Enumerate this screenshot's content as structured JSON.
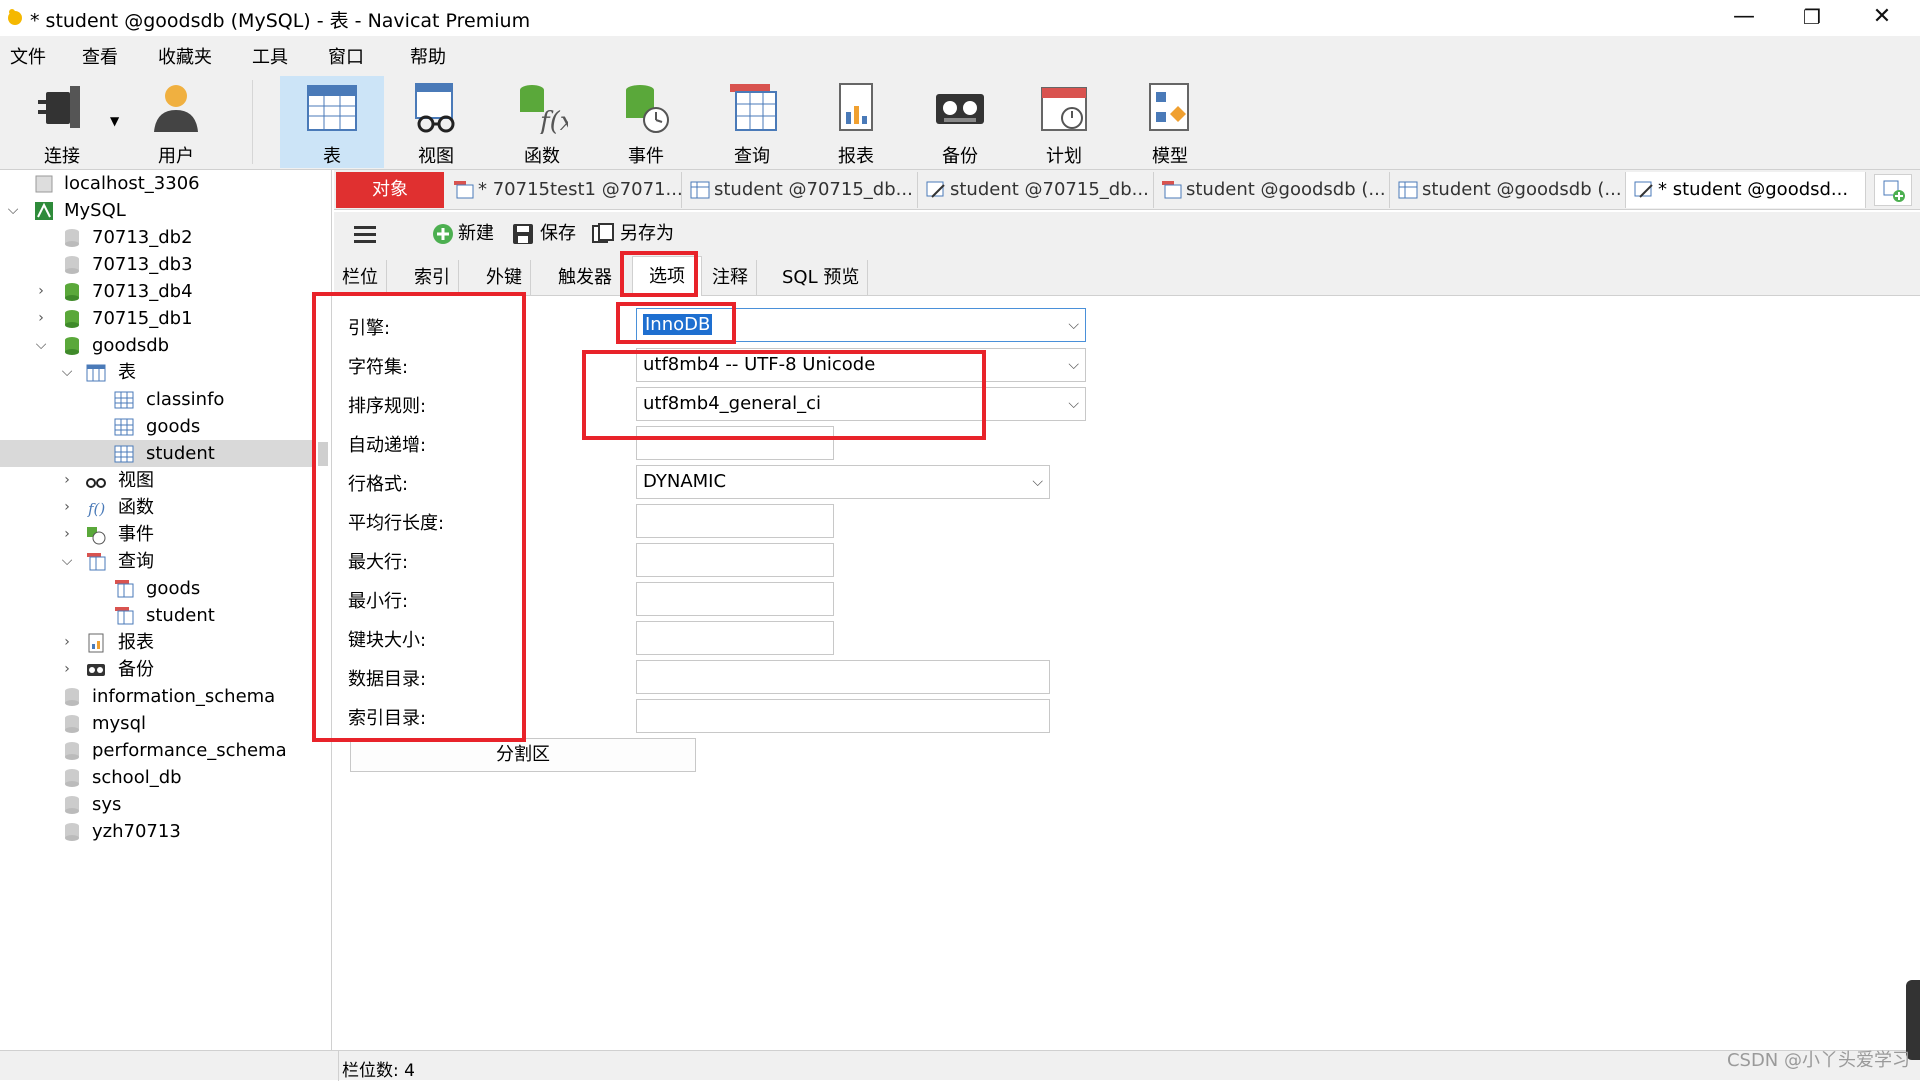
{
  "window": {
    "title": "* student @goodsdb (MySQL) - 表 - Navicat Premium",
    "minimize": "—",
    "restore": "❐",
    "close": "✕"
  },
  "menu": [
    "文件",
    "查看",
    "收藏夹",
    "工具",
    "窗口",
    "帮助"
  ],
  "toolbar": {
    "items": [
      {
        "label": "连接",
        "icon": "plug-icon"
      },
      {
        "label": "用户",
        "icon": "user-icon"
      },
      {
        "label": "表",
        "icon": "table-icon",
        "active": true
      },
      {
        "label": "视图",
        "icon": "view-icon"
      },
      {
        "label": "函数",
        "icon": "function-icon"
      },
      {
        "label": "事件",
        "icon": "event-icon"
      },
      {
        "label": "查询",
        "icon": "query-icon"
      },
      {
        "label": "报表",
        "icon": "report-icon"
      },
      {
        "label": "备份",
        "icon": "backup-icon"
      },
      {
        "label": "计划",
        "icon": "schedule-icon"
      },
      {
        "label": "模型",
        "icon": "model-icon"
      }
    ]
  },
  "sidebar": {
    "items": [
      {
        "label": "localhost_3306"
      },
      {
        "label": "MySQL"
      },
      {
        "label": "70713_db2"
      },
      {
        "label": "70713_db3"
      },
      {
        "label": "70713_db4"
      },
      {
        "label": "70715_db1"
      },
      {
        "label": "goodsdb"
      },
      {
        "label": "表"
      },
      {
        "label": "classinfo"
      },
      {
        "label": "goods"
      },
      {
        "label": "student"
      },
      {
        "label": "视图"
      },
      {
        "label": "函数"
      },
      {
        "label": "事件"
      },
      {
        "label": "查询"
      },
      {
        "label": "goods"
      },
      {
        "label": "student"
      },
      {
        "label": "报表"
      },
      {
        "label": "备份"
      },
      {
        "label": "information_schema"
      },
      {
        "label": "mysql"
      },
      {
        "label": "performance_schema"
      },
      {
        "label": "school_db"
      },
      {
        "label": "sys"
      },
      {
        "label": "yzh70713"
      }
    ]
  },
  "tabs": {
    "object_tab": "对象",
    "docs": [
      "* 70715test1 @7071...",
      "student @70715_db...",
      "student @70715_db...",
      "student @goodsdb (...",
      "student @goodsdb (...",
      "* student @goodsd..."
    ]
  },
  "editor_toolbar": {
    "new": "新建",
    "save": "保存",
    "save_as": "另存为"
  },
  "subtabs": [
    "栏位",
    "索引",
    "外键",
    "触发器",
    "选项",
    "注释",
    "SQL 预览"
  ],
  "form": {
    "labels": [
      "引擎:",
      "字符集:",
      "排序规则:",
      "自动递增:",
      "行格式:",
      "平均行长度:",
      "最大行:",
      "最小行:",
      "键块大小:",
      "数据目录:",
      "索引目录:"
    ],
    "engine": "InnoDB",
    "charset": "utf8mb4 -- UTF-8 Unicode",
    "collation": "utf8mb4_general_ci",
    "auto_increment": "",
    "row_format": "DYNAMIC",
    "partition_button": "分割区"
  },
  "status": {
    "field_count": "栏位数: 4"
  },
  "watermark": "CSDN @小丫头爱学习",
  "colors": {
    "accent_red": "#e8232a",
    "object_tab": "#e03030",
    "toolbar_active": "#cce4f7",
    "selected_row": "#d9d9d9"
  }
}
